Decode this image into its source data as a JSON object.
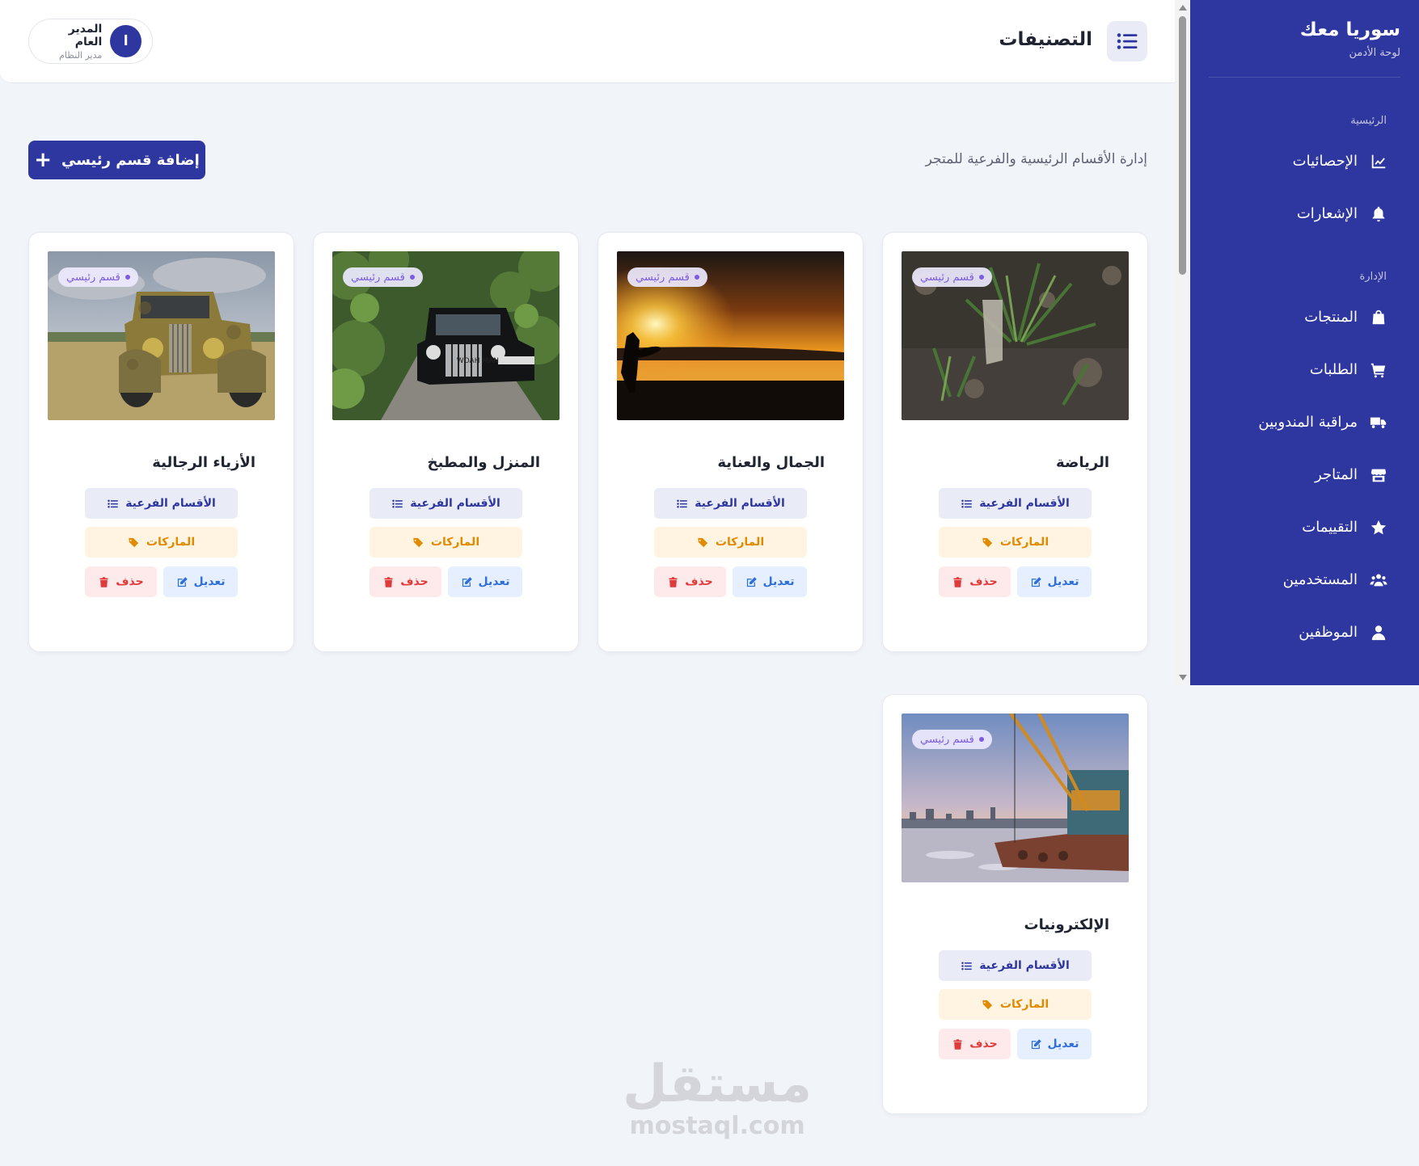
{
  "sidebar": {
    "brand_title": "سوريا معك",
    "brand_subtitle": "لوحة الأدمن",
    "sections": [
      {
        "label": "الرئيسية",
        "items": [
          {
            "label": "الإحصائيات",
            "icon": "chart-line-icon"
          },
          {
            "label": "الإشعارات",
            "icon": "bell-icon"
          }
        ]
      },
      {
        "label": "الإدارة",
        "items": [
          {
            "label": "المنتجات",
            "icon": "shopping-bag-icon"
          },
          {
            "label": "الطلبات",
            "icon": "cart-icon"
          },
          {
            "label": "مراقبة المندوبين",
            "icon": "truck-icon"
          },
          {
            "label": "المتاجر",
            "icon": "store-icon"
          },
          {
            "label": "التقييمات",
            "icon": "star-icon"
          },
          {
            "label": "المستخدمين",
            "icon": "users-icon"
          },
          {
            "label": "الموظفين",
            "icon": "user-tie-icon"
          }
        ]
      }
    ]
  },
  "header": {
    "title": "التصنيفات",
    "menu_icon": "list-icon",
    "user": {
      "initial": "ا",
      "name": "المدير العام",
      "role": "مدير النظام"
    }
  },
  "page": {
    "description": "إدارة الأقسام الرئيسية والفرعية للمتجر",
    "add_button": "إضافة قسم رئيسي"
  },
  "card_labels": {
    "badge": "قسم رئيسي",
    "subcategories": "الأقسام الفرعية",
    "brands": "الماركات",
    "edit": "تعديل",
    "delete": "حذف"
  },
  "categories": [
    {
      "name": "الرياضة",
      "image": "plants-on-rocky-ground"
    },
    {
      "name": "الجمال والعناية",
      "image": "sunset-beach-surfer"
    },
    {
      "name": "المنزل والمطبخ",
      "image": "vintage-black-car-forest-road"
    },
    {
      "name": "الأزياء الرجالية",
      "image": "rusty-old-truck-field"
    },
    {
      "name": "الإلكترونيات",
      "image": "harbor-crane-ship"
    }
  ],
  "watermark": {
    "arabic": "مستقل",
    "latin": "mostaql.com"
  },
  "colors": {
    "primary": "#2e369f",
    "badge": "#7c5ce0",
    "brands": "#e08a00",
    "edit": "#2f6fd8",
    "delete": "#e03b3b",
    "background": "#f1f4f9"
  }
}
